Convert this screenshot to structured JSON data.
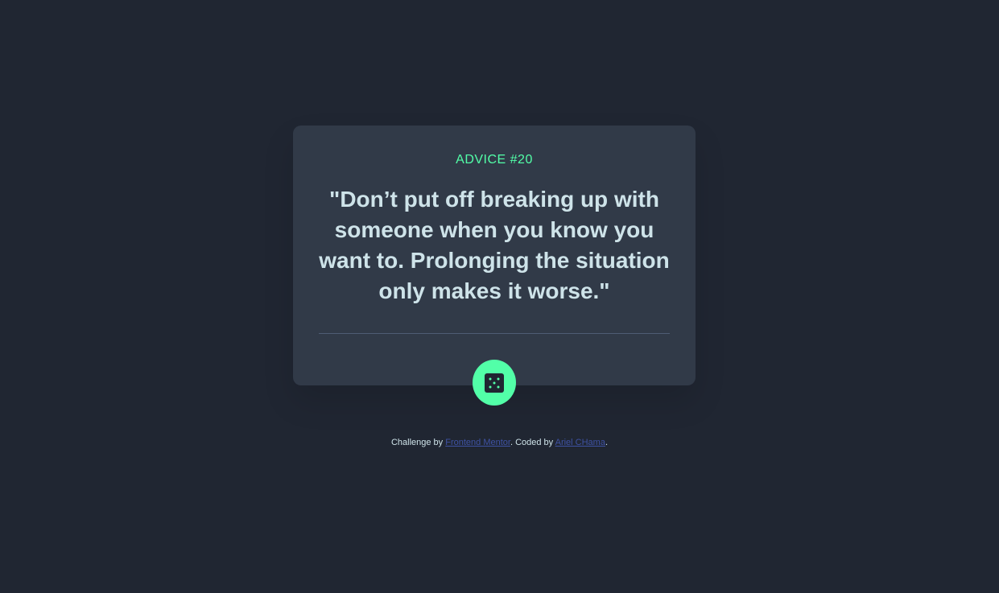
{
  "advice": {
    "label": "ADVICE #20",
    "quote": "\"Don’t put off breaking up with someone when you know you want to. Prolonging the situation only makes it worse.\""
  },
  "dice_button": {
    "icon": "dice-icon"
  },
  "attribution": {
    "challenge_prefix": "Challenge by ",
    "challenge_link": "Frontend Mentor",
    "coded_prefix": ". Coded by ",
    "coded_link": "Ariel CHama",
    "suffix": "."
  },
  "colors": {
    "background": "#202632",
    "card": "#313a48",
    "accent": "#52ffa8",
    "text": "#cee3e9",
    "divider": "#4f5d74",
    "link": "#3e52a3"
  }
}
